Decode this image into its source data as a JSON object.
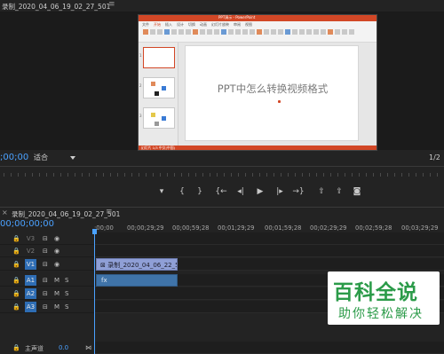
{
  "monitor": {
    "sequence_title": "录制_2020_04_06_19_02_27_501",
    "menu_icon": "≡",
    "timecode": ";00;00",
    "fit_value": "适合",
    "fraction": "1/2"
  },
  "embedded_ppt": {
    "window_title": "PPT演示 - PowerPoint",
    "ribbon_tabs": [
      "文件",
      "开始",
      "插入",
      "设计",
      "切换",
      "动画",
      "幻灯片放映",
      "审阅",
      "视图"
    ],
    "slide_text": "PPT中怎么转换视频格式",
    "status_text": "幻灯片 1/3  中文(中国)",
    "thumb_numbers": [
      "1",
      "2",
      "3"
    ]
  },
  "transport": {
    "buttons": [
      {
        "name": "add-marker-button",
        "glyph": "▾"
      },
      {
        "name": "mark-in-button",
        "glyph": "{"
      },
      {
        "name": "mark-out-button",
        "glyph": "}"
      },
      {
        "name": "go-to-in-button",
        "glyph": "{←"
      },
      {
        "name": "step-back-button",
        "glyph": "◂|"
      },
      {
        "name": "play-button",
        "glyph": "▶"
      },
      {
        "name": "step-forward-button",
        "glyph": "|▸"
      },
      {
        "name": "go-to-out-button",
        "glyph": "→}"
      },
      {
        "name": "lift-button",
        "glyph": "⇧"
      },
      {
        "name": "extract-button",
        "glyph": "⇪"
      },
      {
        "name": "export-frame-button",
        "glyph": "◙"
      }
    ]
  },
  "timeline": {
    "close_icon": "×",
    "sequence_title": "录制_2020_04_06_19_02_27_501",
    "menu_icon": "≡",
    "timecode": "00;00;00;00",
    "ruler_labels": [
      ";00;00",
      "00;00;29;29",
      "00;00;59;28",
      "00;01;29;29",
      "00;01;59;28",
      "00;02;29;29",
      "00;02;59;28",
      "00;03;29;29"
    ],
    "tracks": [
      {
        "id": "V3",
        "type": "video",
        "targeted": false
      },
      {
        "id": "V2",
        "type": "video",
        "targeted": false
      },
      {
        "id": "V1",
        "type": "video",
        "targeted": true
      },
      {
        "id": "A1",
        "type": "audio",
        "targeted": true
      },
      {
        "id": "A2",
        "type": "audio",
        "targeted": true
      },
      {
        "id": "A3",
        "type": "audio",
        "targeted": true
      }
    ],
    "mute_label": "M",
    "solo_label": "S",
    "master_label": "主声道",
    "master_value": "0.0",
    "video_clip_label": "录制_2020_04_06_22_5",
    "audio_clip_icon": "fx"
  },
  "watermark": {
    "big": "百科全说",
    "small": "助你轻松解决"
  },
  "colors": {
    "timecode_blue": "#4aa1ff",
    "track_target": "#2e6db4",
    "video_clip": "#8f9fd6",
    "audio_clip": "#3f73a8",
    "work_area": "#d9c13a",
    "ppt_accent": "#d24726",
    "watermark_green": "#2b9b49"
  }
}
